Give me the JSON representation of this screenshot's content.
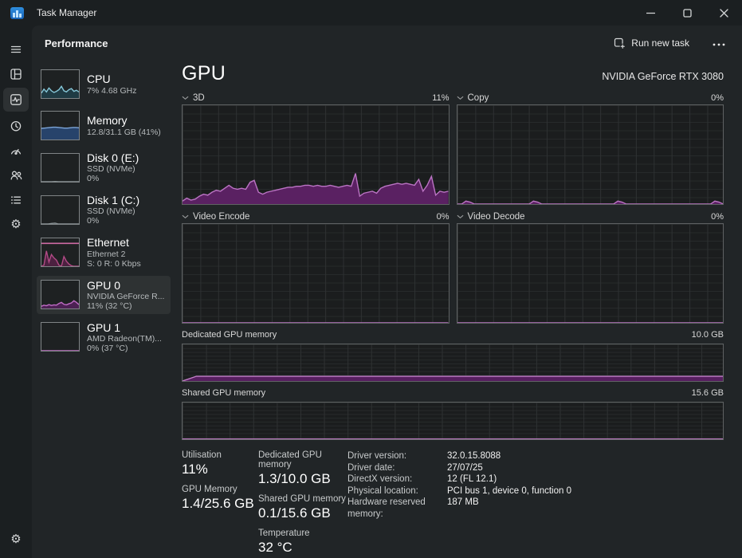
{
  "window": {
    "title": "Task Manager"
  },
  "header": {
    "title": "Performance",
    "run_new_task_label": "Run new task"
  },
  "icons": {
    "titlebar": [
      "task-manager-logo",
      "minimize",
      "maximize",
      "close"
    ],
    "rail": [
      "menu",
      "processes",
      "performance",
      "app-history",
      "startup-apps",
      "users",
      "details",
      "services",
      "settings"
    ],
    "services_glyph": "⚙",
    "settings_glyph": "⚙",
    "accent_blue": "#4cc2ff"
  },
  "sidebar": {
    "items": [
      {
        "title": "CPU",
        "sub1": "7% 4.68 GHz",
        "sub2": "",
        "spark": {
          "values": [
            18,
            32,
            22,
            36,
            26,
            20,
            24,
            30,
            42,
            26,
            22,
            30,
            34,
            24,
            28,
            22
          ],
          "ylim": [
            0,
            100
          ],
          "line": "#85c6d8",
          "fill": "#1f3b44"
        }
      },
      {
        "title": "Memory",
        "sub1": "12.8/31.1 GB (41%)",
        "sub2": "",
        "spark": {
          "values": [
            40,
            41,
            42,
            43,
            44,
            44,
            43,
            42,
            41,
            41,
            42,
            43,
            43,
            42
          ],
          "ylim": [
            0,
            100
          ],
          "line": "#7da6d9",
          "fill": "#27436b"
        }
      },
      {
        "title": "Disk 0 (E:)",
        "sub1": "SSD (NVMe)",
        "sub2": "0%",
        "spark": {
          "values": [
            0,
            0,
            0,
            0,
            1,
            0,
            0,
            0,
            0,
            0,
            0,
            0
          ],
          "ylim": [
            0,
            100
          ],
          "line": "#8a9396",
          "fill": "#343a3c"
        }
      },
      {
        "title": "Disk 1 (C:)",
        "sub1": "SSD (NVMe)",
        "sub2": "0%",
        "spark": {
          "values": [
            0,
            0,
            0,
            2,
            3,
            0,
            0,
            0,
            0,
            0,
            0,
            0
          ],
          "ylim": [
            0,
            100
          ],
          "line": "#8a9396",
          "fill": "#343a3c"
        }
      },
      {
        "title": "Ethernet",
        "sub1": "Ethernet 2",
        "sub2": "S: 0 R: 0 Kbps",
        "spark": {
          "values": [
            0,
            4,
            55,
            15,
            42,
            30,
            22,
            4,
            0,
            35,
            18,
            8,
            2,
            0,
            0,
            0
          ],
          "ylim": [
            0,
            100
          ],
          "line": "#b14a85",
          "fill": "#4c2140",
          "topline": 18,
          "topline_color": "#cf6aa4"
        }
      },
      {
        "title": "GPU 0",
        "sub1": "NVIDIA GeForce R...",
        "sub2": "11% (32 °C)",
        "selected": true,
        "spark": {
          "values": [
            8,
            12,
            10,
            14,
            11,
            13,
            12,
            18,
            22,
            15,
            13,
            17,
            20,
            28,
            22,
            14
          ],
          "ylim": [
            0,
            100
          ],
          "line": "#c06cc6",
          "fill": "#4c2153"
        }
      },
      {
        "title": "GPU 1",
        "sub1": "AMD Radeon(TM)...",
        "sub2": "0% (37 °C)",
        "spark": {
          "values": [
            0,
            0,
            0,
            0,
            0,
            0,
            0,
            0,
            0,
            0,
            0,
            0
          ],
          "ylim": [
            0,
            100
          ],
          "line": "#c06cc6",
          "fill": "#4c2153"
        }
      }
    ]
  },
  "gpu": {
    "heading": "GPU",
    "device_name": "NVIDIA GeForce RTX 3080"
  },
  "chart_data": [
    {
      "type": "area",
      "label": "3D",
      "value_label": "11%",
      "ylabel": "utilization %",
      "ylim": [
        0,
        100
      ],
      "line": "#bb74c4",
      "fill": "#5a2162",
      "grid": true,
      "values": [
        3,
        6,
        4,
        5,
        8,
        10,
        9,
        12,
        14,
        13,
        16,
        19,
        16,
        15,
        16,
        15,
        22,
        24,
        12,
        10,
        12,
        13,
        14,
        15,
        16,
        17,
        17,
        18,
        18,
        19,
        19,
        18,
        19,
        18,
        18,
        19,
        18,
        17,
        18,
        19,
        18,
        31,
        8,
        11,
        12,
        13,
        11,
        16,
        18,
        19,
        20,
        21,
        20,
        21,
        20,
        19,
        25,
        13,
        19,
        28,
        9,
        13,
        12,
        13
      ]
    },
    {
      "type": "area",
      "label": "Copy",
      "value_label": "0%",
      "ylabel": "utilization %",
      "ylim": [
        0,
        100
      ],
      "line": "#bb74c4",
      "fill": "#5a2162",
      "grid": true,
      "values": [
        0,
        0,
        3,
        2,
        0,
        0,
        0,
        0,
        0,
        0,
        0,
        0,
        0,
        0,
        0,
        0,
        0,
        0,
        3,
        2,
        0,
        0,
        0,
        0,
        0,
        0,
        0,
        0,
        0,
        0,
        0,
        0,
        0,
        0,
        0,
        0,
        0,
        0,
        3,
        2,
        0,
        0,
        0,
        0,
        0,
        0,
        0,
        0,
        0,
        0,
        0,
        0,
        0,
        0,
        0,
        0,
        0,
        0,
        0,
        0,
        0,
        3,
        2,
        0
      ]
    },
    {
      "type": "area",
      "label": "Video Encode",
      "value_label": "0%",
      "ylabel": "utilization %",
      "ylim": [
        0,
        100
      ],
      "line": "#bb74c4",
      "fill": "#5a2162",
      "grid": true,
      "values": [
        0,
        0,
        0,
        0,
        0,
        0,
        0,
        0,
        0,
        0,
        0,
        0,
        0,
        0,
        0,
        0,
        0,
        0,
        0,
        0,
        0,
        0,
        0,
        0,
        0,
        0,
        0,
        0,
        0,
        0,
        0,
        0
      ]
    },
    {
      "type": "area",
      "label": "Video Decode",
      "value_label": "0%",
      "ylabel": "utilization %",
      "ylim": [
        0,
        100
      ],
      "line": "#bb74c4",
      "fill": "#5a2162",
      "grid": true,
      "values": [
        0,
        0,
        0,
        0,
        0,
        0,
        0,
        0,
        0,
        0,
        0,
        0,
        0,
        0,
        0,
        0,
        0,
        0,
        0,
        0,
        0,
        0,
        0,
        0,
        0,
        0,
        0,
        0,
        0,
        0,
        0,
        0
      ]
    },
    {
      "type": "area",
      "label": "Dedicated GPU memory",
      "value_label": "10.0 GB",
      "ylabel": "GB",
      "ylim": [
        0,
        10
      ],
      "line": "#c27fc7",
      "fill": "#571f60",
      "grid": true,
      "values": [
        0,
        1.3,
        1.3,
        1.3,
        1.3,
        1.3,
        1.3,
        1.3,
        1.3,
        1.3,
        1.3,
        1.3,
        1.3,
        1.3,
        1.3,
        1.3,
        1.3,
        1.3,
        1.3,
        1.3,
        1.3,
        1.3,
        1.3,
        1.3,
        1.3,
        1.3,
        1.3,
        1.3,
        1.3,
        1.3,
        1.3,
        1.3,
        1.3,
        1.3,
        1.3,
        1.3,
        1.3,
        1.3,
        1.3,
        1.3
      ]
    },
    {
      "type": "area",
      "label": "Shared GPU memory",
      "value_label": "15.6 GB",
      "ylabel": "GB",
      "ylim": [
        0,
        15.6
      ],
      "line": "#c27fc7",
      "fill": "#571f60",
      "grid": true,
      "values": [
        0.1,
        0.1,
        0.1,
        0.1,
        0.1,
        0.1,
        0.1,
        0.1,
        0.1,
        0.1,
        0.1,
        0.1,
        0.1,
        0.1,
        0.1,
        0.1,
        0.1,
        0.1,
        0.1,
        0.1,
        0.1,
        0.1,
        0.1,
        0.1,
        0.1,
        0.1,
        0.1,
        0.1,
        0.1,
        0.1,
        0.1,
        0.1,
        0.1,
        0.1,
        0.1,
        0.1,
        0.1,
        0.1,
        0.1,
        0.1
      ]
    }
  ],
  "stats": {
    "col1": [
      {
        "label": "Utilisation",
        "value": "11%"
      },
      {
        "label": "GPU Memory",
        "value": "1.4/25.6 GB"
      }
    ],
    "col2": [
      {
        "label": "Dedicated GPU memory",
        "value": "1.3/10.0 GB"
      },
      {
        "label": "Shared GPU memory",
        "value": "0.1/15.6 GB"
      },
      {
        "label": "Temperature",
        "value": "32 °C"
      }
    ]
  },
  "details": [
    {
      "label": "Driver version:",
      "value": "32.0.15.8088"
    },
    {
      "label": "Driver date:",
      "value": "27/07/25"
    },
    {
      "label": "DirectX version:",
      "value": "12 (FL 12.1)"
    },
    {
      "label": "Physical location:",
      "value": "PCI bus 1, device 0, function 0"
    },
    {
      "label": "Hardware reserved memory:",
      "value": "187 MB"
    }
  ]
}
